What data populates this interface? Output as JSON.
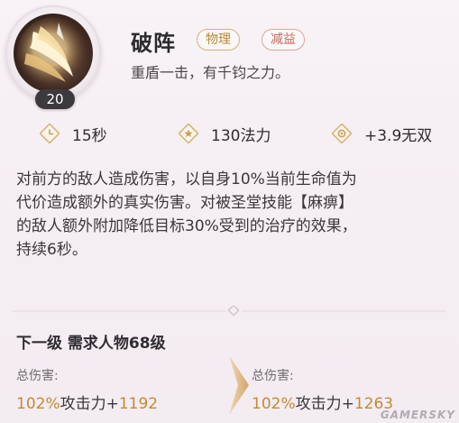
{
  "skill": {
    "level": "20",
    "name": "破阵",
    "tags": [
      "物理",
      "减益"
    ],
    "subtitle": "重盾一击，有千钧之力。"
  },
  "stats": {
    "cooldown": "15秒",
    "cost": "130法力",
    "musou": "+3.9无双"
  },
  "description": [
    "对前方的敌人造成伤害，以自身10%当前生命值为",
    "代价造成额外的真实伤害。对被圣堂技能【麻痹】",
    "的敌人额外附加降低目标30%受到的治疗的效果，",
    "持续6秒。"
  ],
  "next_level": {
    "title": "下一级 需求人物68级",
    "current": {
      "label": "总伤害:",
      "pct": "102%",
      "mid": "攻击力+",
      "num": "1192"
    },
    "next": {
      "label": "总伤害:",
      "pct": "102%",
      "mid": "攻击力+",
      "num": "1263"
    }
  },
  "watermark": "GAMERSKY",
  "colors": {
    "gold": "#c48a33",
    "tag_physical": "#b78a35",
    "tag_debuff": "#c56a5d"
  },
  "icons": [
    "blade-skill-icon",
    "clock-icon",
    "star-icon",
    "musou-icon",
    "chevron-right-icon"
  ]
}
